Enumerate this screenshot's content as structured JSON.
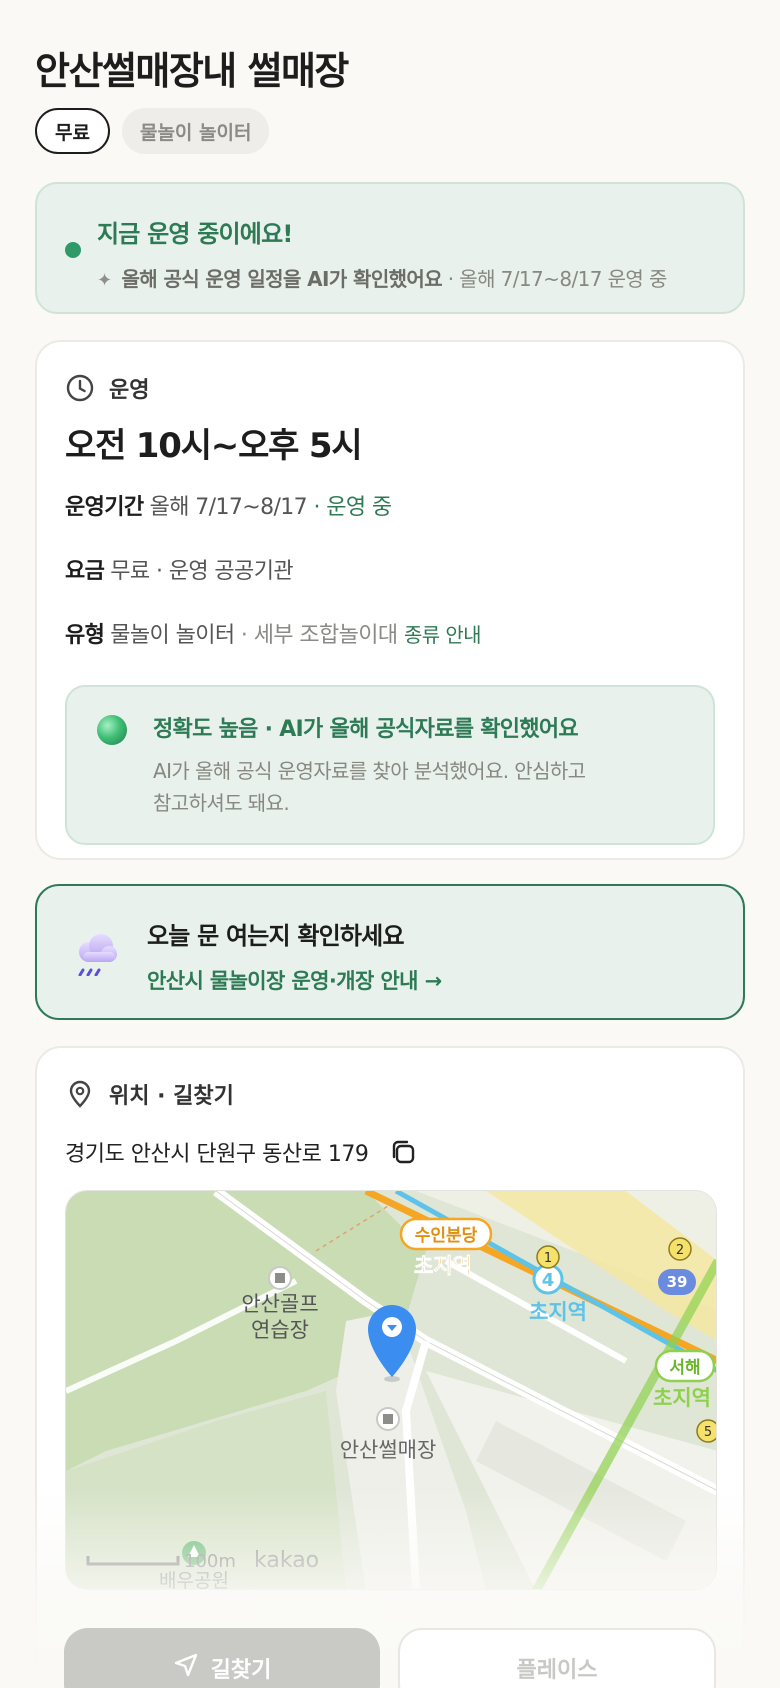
{
  "header": {
    "title": "안산썰매장내 썰매장",
    "chips": [
      "무료",
      "물놀이 놀이터"
    ]
  },
  "status": {
    "title": "지금 운영 중이에요!",
    "ai_note": "올해 공식 운영 일정을 AI가 확인했어요",
    "period_note": " · 올해 7/17~8/17 운영 중"
  },
  "operation": {
    "section_label": "운영",
    "hours": "오전 10시~오후 5시",
    "period_key": "운영기간",
    "period_value": "올해 7/17~8/17",
    "period_status": " · 운영 중",
    "fee_key": "요금",
    "fee_value": "무료 · 운영 공공기관",
    "type_key": "유형",
    "type_value": "물놀이 놀이터",
    "type_detail": " · 세부 조합놀이대",
    "type_link": "종류 안내",
    "accuracy_title": "정확도 높음 · AI가 올해 공식자료를 확인했어요",
    "accuracy_desc_1": "AI가 올해 공식 운영자료를 찾아 분석했어요. 안심하고",
    "accuracy_desc_2": "참고하셔도 돼요."
  },
  "notice": {
    "title": "오늘 문 여는지 확인하세요",
    "link": "안산시 물놀이장 운영·개장 안내 →"
  },
  "location": {
    "section_label": "위치 · 길찾기",
    "address": "경기도 안산시 단원구 동산로 179"
  },
  "map": {
    "labels": {
      "golf": [
        "안산골프",
        "연습장"
      ],
      "sled": "안산썰매장",
      "station1_tag": "수인분당",
      "station1": "초지역",
      "station2": "초지역",
      "station3_tag": "서해",
      "station3": "초지역",
      "park": "배우공원",
      "scale": "100m",
      "brand": "kakao"
    },
    "badges": [
      "1",
      "4",
      "2",
      "39",
      "5"
    ],
    "colors": {
      "green_area": "#c9dcb4",
      "road": "#ffffff",
      "rail_yellow": "#f6e79a",
      "line_suin": "#f5a623",
      "line_4": "#5ec3e8",
      "line_seohae": "#8fd14f",
      "pin": "#3b8df0"
    }
  },
  "bottom_bar": {
    "directions": "길찾기",
    "place": "플레이스"
  },
  "colors": {
    "accent_green": "#2d7a55",
    "soft_green_bg": "#e8f1ec"
  }
}
